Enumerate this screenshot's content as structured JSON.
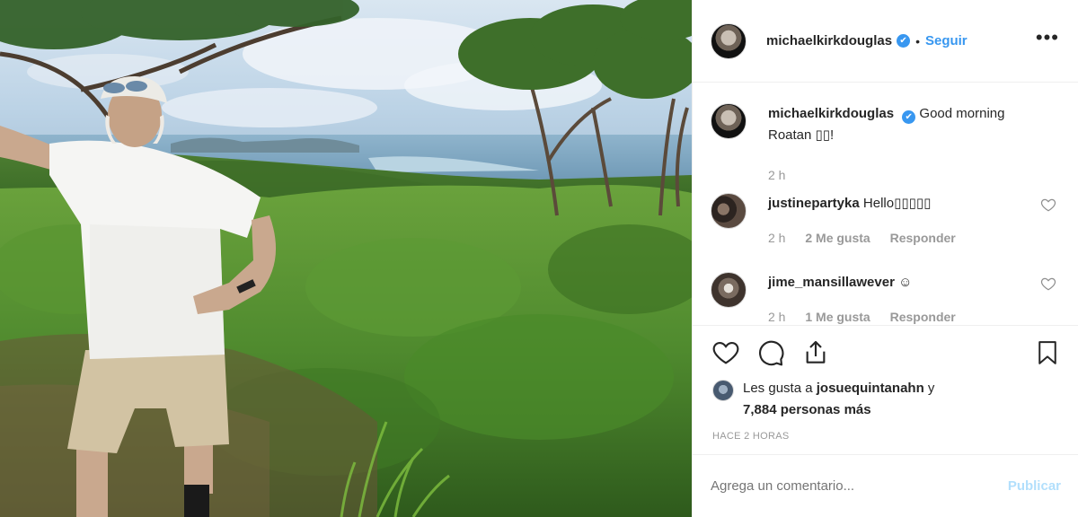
{
  "post": {
    "username": "michaelkirkdouglas",
    "verified_glyph": "✔",
    "separator": "•",
    "follow_label": "Seguir",
    "more_label": "•••",
    "photo": {
      "description_icon": "landscape-photo",
      "sky_color": "#bcd3e6",
      "sea_color": "#7fa8c4",
      "vegetation_color": "#4f8a2e"
    }
  },
  "comments": [
    {
      "username": "michaelkirkdouglas",
      "text": "Good morning Roatan ▯▯!",
      "time": "2 h",
      "likes": "",
      "reply": ""
    },
    {
      "username": "justinepartyka",
      "text": "Hello▯▯▯▯▯",
      "time": "2 h",
      "likes": "2 Me gusta",
      "reply": "Responder"
    },
    {
      "username": "jime_mansillawever",
      "text": "☺",
      "time": "2 h",
      "likes": "1 Me gusta",
      "reply": "Responder"
    }
  ],
  "actions": {
    "like_icon": "heart-icon",
    "comment_icon": "comment-icon",
    "share_icon": "share-icon",
    "save_icon": "bookmark-icon"
  },
  "likes": {
    "prefix": "Les gusta a",
    "user": "josuequintanahn",
    "connector": "y",
    "count_text": "7,884 personas más"
  },
  "timestamp": "HACE 2 HORAS",
  "add_comment": {
    "placeholder": "Agrega un comentario...",
    "publish_label": "Publicar"
  },
  "colors": {
    "accent": "#3897f0",
    "publish_disabled": "#b2dffc",
    "muted_text": "#999999",
    "border": "#efefef"
  }
}
